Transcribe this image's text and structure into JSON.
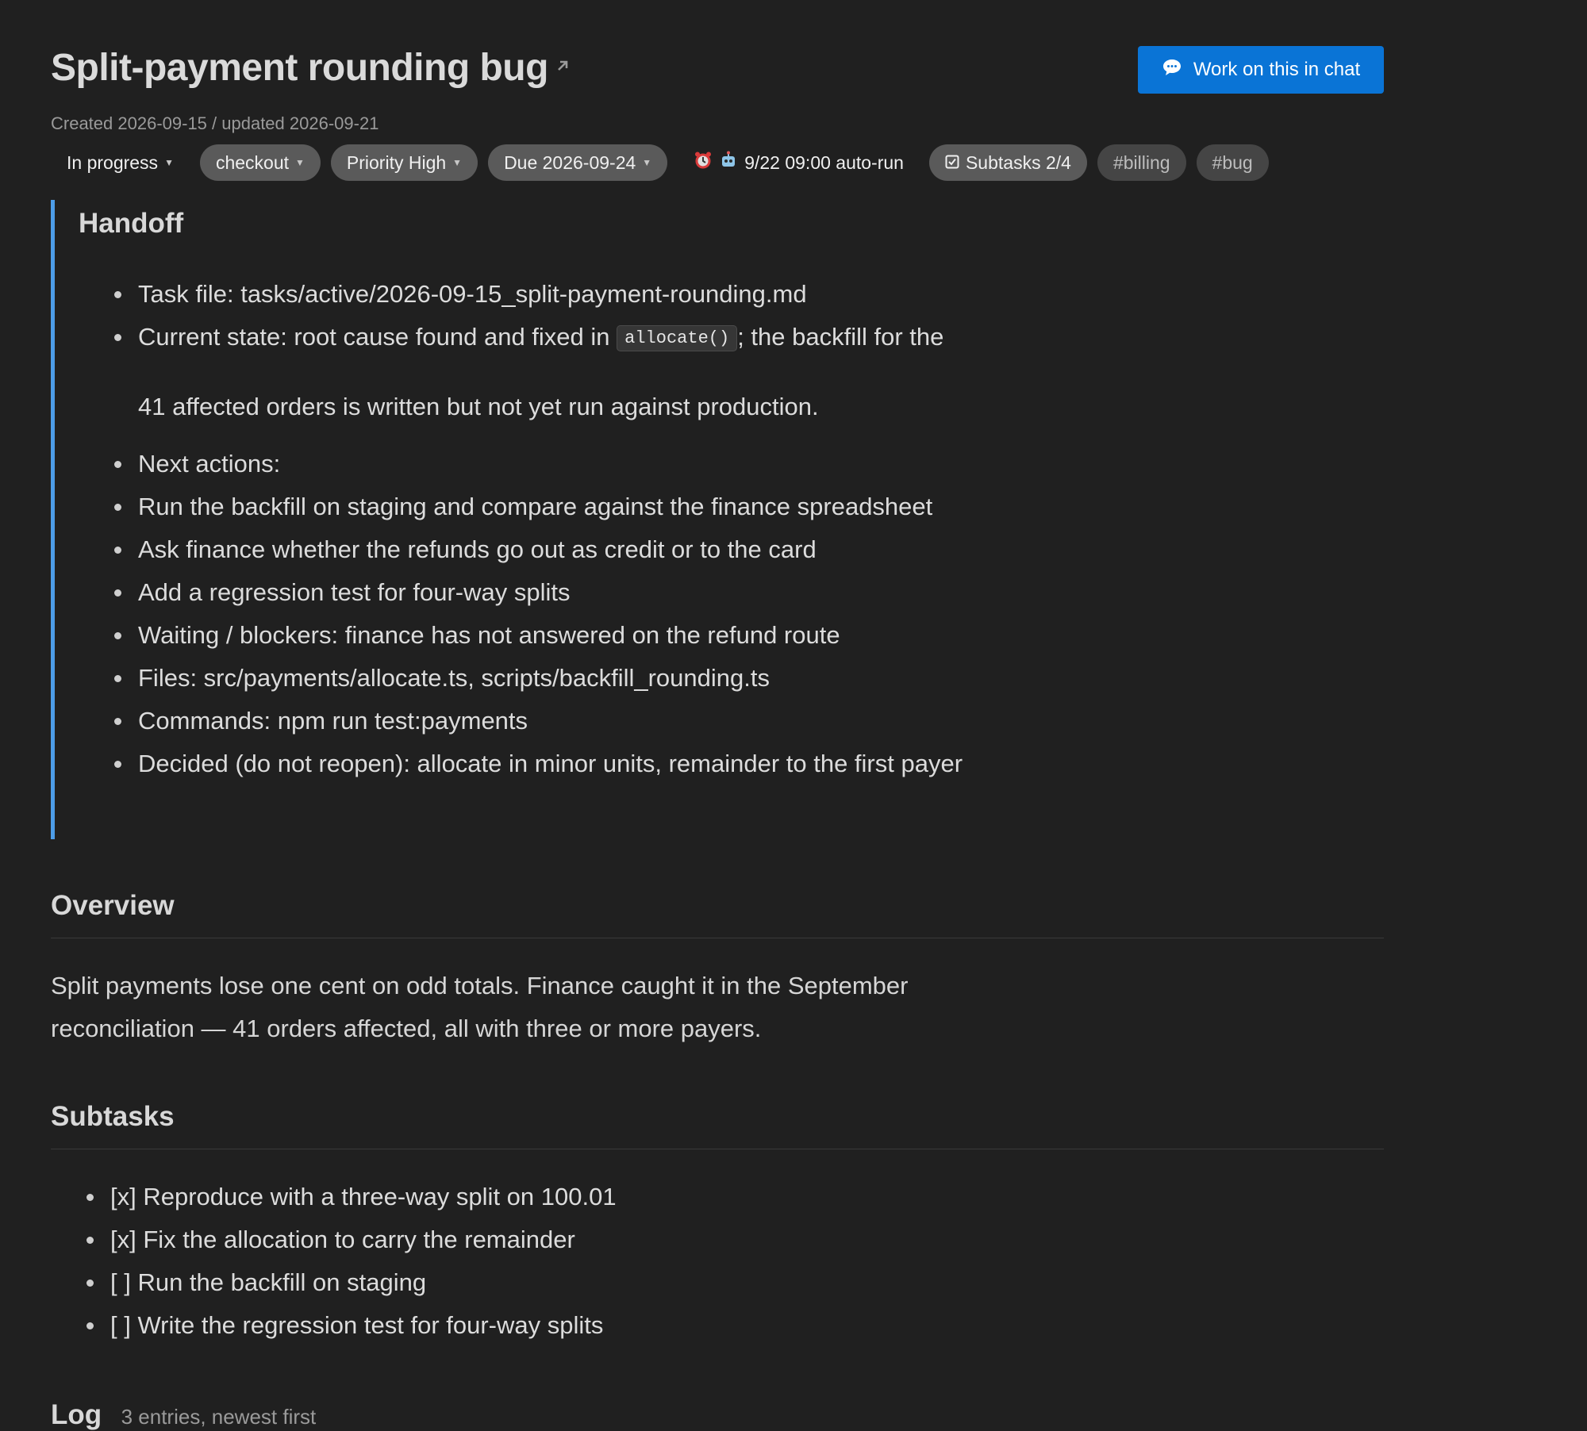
{
  "task": {
    "title": "Split-payment rounding bug",
    "meta": "Created 2026-09-15 / updated 2026-09-21",
    "chat_button": "Work on this in chat"
  },
  "chips": {
    "status": "In progress",
    "area": "checkout",
    "priority": "Priority High",
    "due": "Due 2026-09-24",
    "autorun": "9/22 09:00 auto-run",
    "subtasks": "Subtasks 2/4",
    "tags": [
      "#billing",
      "#bug"
    ]
  },
  "handoff": {
    "heading": "Handoff",
    "task_file": "Task file: tasks/active/2026-09-15_split-payment-rounding.md",
    "state_prefix": "Current state: root cause found and fixed in",
    "state_code": "allocate()",
    "state_suffix": "; the backfill for the",
    "state_cont": "41 affected orders is written but not yet run against production.",
    "items": [
      "Next actions:",
      "Run the backfill on staging and compare against the finance spreadsheet",
      "Ask finance whether the refunds go out as credit or to the card",
      "Add a regression test for four-way splits",
      "Waiting / blockers: finance has not answered on the refund route",
      "Files: src/payments/allocate.ts, scripts/backfill_rounding.ts",
      "Commands: npm run test:payments",
      "Decided (do not reopen): allocate in minor units, remainder to the first payer"
    ]
  },
  "overview": {
    "heading": "Overview",
    "line1": "Split payments lose one cent on odd totals. Finance caught it in the September",
    "line2": "reconciliation — 41 orders affected, all with three or more payers."
  },
  "subtasks": {
    "heading": "Subtasks",
    "items": [
      "[x] Reproduce with a three-way split on 100.01",
      "[x] Fix the allocation to carry the remainder",
      "[ ] Run the backfill on staging",
      "[ ] Write the regression test for four-way splits"
    ]
  },
  "log": {
    "heading": "Log",
    "subtitle": "3 entries, newest first"
  },
  "colors": {
    "background": "#202020",
    "accent_button": "#0a74d6",
    "handoff_border": "#4d9de8"
  }
}
